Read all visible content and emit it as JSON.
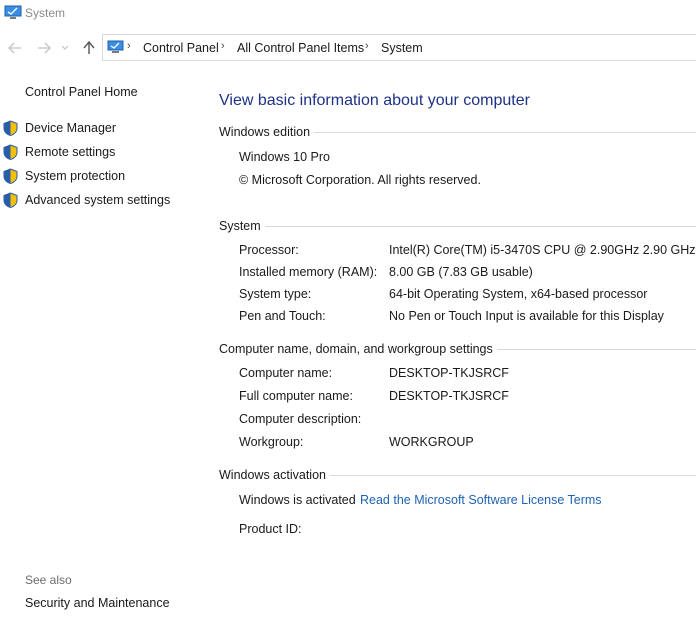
{
  "window": {
    "title": "System"
  },
  "breadcrumb": [
    "Control Panel",
    "All Control Panel Items",
    "System"
  ],
  "sidebar": {
    "home": "Control Panel Home",
    "items": [
      {
        "label": "Device Manager"
      },
      {
        "label": "Remote settings"
      },
      {
        "label": "System protection"
      },
      {
        "label": "Advanced system settings"
      }
    ],
    "see_also_title": "See also",
    "see_also_items": [
      {
        "label": "Security and Maintenance"
      }
    ]
  },
  "main": {
    "heading": "View basic information about your computer",
    "edition": {
      "title": "Windows edition",
      "name": "Windows 10 Pro",
      "copyright": "© Microsoft Corporation. All rights reserved."
    },
    "system": {
      "title": "System",
      "rows": [
        {
          "label": "Processor:",
          "value": "Intel(R) Core(TM) i5-3470S CPU @ 2.90GHz   2.90 GHz"
        },
        {
          "label": "Installed memory (RAM):",
          "value": "8.00 GB (7.83 GB usable)"
        },
        {
          "label": "System type:",
          "value": "64-bit Operating System, x64-based processor"
        },
        {
          "label": "Pen and Touch:",
          "value": "No Pen or Touch Input is available for this Display"
        }
      ]
    },
    "computer_name": {
      "title": "Computer name, domain, and workgroup settings",
      "rows": [
        {
          "label": "Computer name:",
          "value": "DESKTOP-TKJSRCF"
        },
        {
          "label": "Full computer name:",
          "value": "DESKTOP-TKJSRCF"
        },
        {
          "label": "Computer description:",
          "value": ""
        },
        {
          "label": "Workgroup:",
          "value": "WORKGROUP"
        }
      ]
    },
    "activation": {
      "title": "Windows activation",
      "status": "Windows is activated",
      "license_link": "Read the Microsoft Software License Terms",
      "product_id_label": "Product ID:"
    }
  },
  "colors": {
    "heading": "#1e3287",
    "link": "#1e62b4",
    "accent": "#0078d7"
  }
}
